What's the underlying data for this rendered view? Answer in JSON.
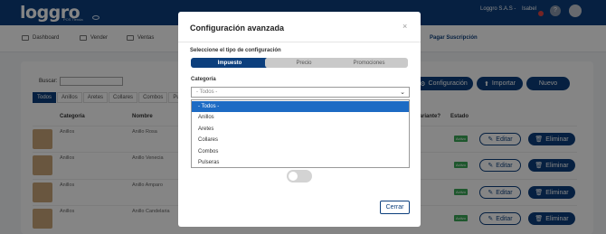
{
  "header": {
    "logo": "loggro",
    "logo_sub": "POS Tienda",
    "company": "Loggro S.A.S -",
    "user": "Isabel",
    "help_glyph": "?"
  },
  "nav": {
    "items": [
      {
        "label": "Dashboard",
        "icon": "dashboard-icon"
      },
      {
        "label": "Vender",
        "icon": "cart-icon"
      },
      {
        "label": "Ventas",
        "icon": "sales-icon"
      }
    ],
    "pay": "Pagar Suscripción"
  },
  "page": {
    "search_label": "Buscar:",
    "tabs": [
      "Todos",
      "Anillos",
      "Aretes",
      "Collares",
      "Combos",
      "Pu"
    ],
    "buttons": {
      "config": "Configuración",
      "import": "Importar",
      "new": "Nuevo"
    },
    "columns": {
      "category": "Categoría",
      "name": "Nombre",
      "variant": "Variante?",
      "status": "Estado"
    },
    "rows": [
      {
        "category": "Anillos",
        "name": "Anillo Rosa",
        "status": "Activo",
        "edit": "Editar",
        "delete": "Eliminar"
      },
      {
        "category": "Anillos",
        "name": "Anillo Venecia",
        "status": "Activo",
        "edit": "Editar",
        "delete": "Eliminar"
      },
      {
        "category": "Anillos",
        "name": "Anillo Amparo",
        "status": "Activo",
        "edit": "Editar",
        "delete": "Eliminar"
      },
      {
        "category": "Anillos",
        "name": "Anillo Candelaria",
        "status": "Activo",
        "edit": "Editar",
        "delete": "Eliminar"
      }
    ]
  },
  "modal": {
    "title": "Configuración avanzada",
    "close": "×",
    "subtitle": "Seleccione el tipo de configuración",
    "segments": [
      "Impuesto",
      "Precio",
      "Promociones"
    ],
    "category_label": "Categoría",
    "category_value": "- Todos -",
    "options": [
      "- Todos -",
      "Anillos",
      "Aretes",
      "Collares",
      "Combos",
      "Pulseras"
    ],
    "selected_option": "- Todos -",
    "close_button": "Cerrar"
  },
  "colors": {
    "primary": "#0c3f7d",
    "selected": "#1d6bc4",
    "active_badge": "#3aa757"
  }
}
